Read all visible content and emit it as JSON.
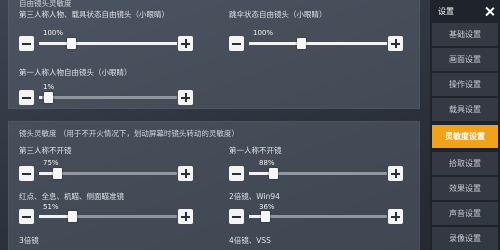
{
  "panel1": {
    "title": "自由镜头灵敏度",
    "sliders": [
      {
        "label": "第三人称人物、载具状态自由镜头（小眼睛）",
        "value": "100%",
        "fraction": 1.0
      },
      {
        "label": "跳伞状态自由镜头（小眼睛）",
        "value": "100%",
        "fraction": 1.0
      },
      {
        "label": "第一人称人物自由镜头（小眼睛）",
        "value": "1%",
        "fraction": 0.01
      }
    ]
  },
  "panel2": {
    "title": "镜头灵敏度  （用于不开火情况下，划动屏幕时镜头转动的灵敏度）",
    "sliders": [
      {
        "label": "第三人称不开镜",
        "value": "75%",
        "fraction": 0.75
      },
      {
        "label": "第一人称不开镜",
        "value": "88%",
        "fraction": 0.88
      },
      {
        "label": "红点、全息、机瞄、侧面瞄准镜",
        "value": "51%",
        "fraction": 0.51
      },
      {
        "label": "2倍镜、Win94",
        "value": "36%",
        "fraction": 0.36
      },
      {
        "label": "3倍镜",
        "value": "",
        "fraction": 0
      },
      {
        "label": "4倍镜、VSS",
        "value": "",
        "fraction": 0
      }
    ]
  },
  "menu": {
    "title": "设置",
    "items": [
      {
        "label": "基础设置",
        "active": false
      },
      {
        "label": "画面设置",
        "active": false
      },
      {
        "label": "操作设置",
        "active": false
      },
      {
        "label": "载具设置",
        "active": false
      },
      {
        "label": "灵敏度设置",
        "active": true
      },
      {
        "label": "拾取设置",
        "active": false
      },
      {
        "label": "效果设置",
        "active": false
      },
      {
        "label": "声音设置",
        "active": false
      },
      {
        "label": "录像设置",
        "active": false
      }
    ]
  },
  "colors": {
    "accent": "#f0a21a",
    "menu_bg": "#1e2229",
    "panel_bg": "#58606e"
  }
}
